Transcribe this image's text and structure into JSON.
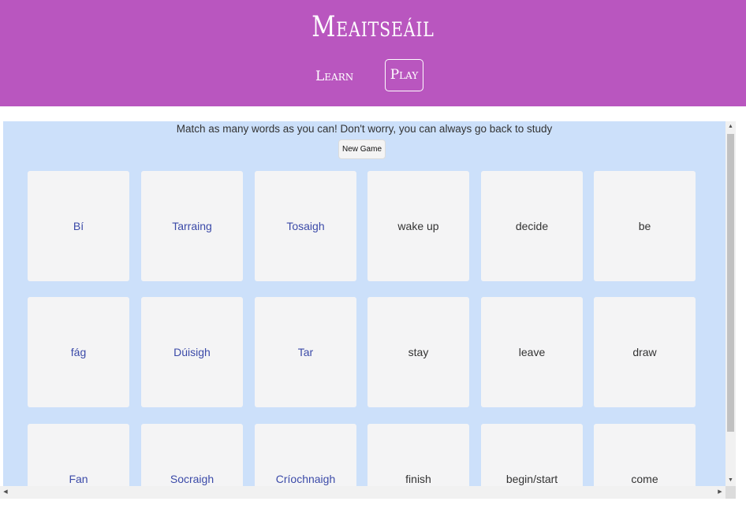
{
  "header": {
    "title": "Meaitseáil",
    "nav": {
      "learn": "Learn",
      "play": "Play"
    }
  },
  "game": {
    "instructions": "Match as many words as you can! Don't worry, you can always go back to study",
    "new_game_label": "New Game",
    "cards": [
      {
        "text": "Bí",
        "lang": "irish"
      },
      {
        "text": "Tarraing",
        "lang": "irish"
      },
      {
        "text": "Tosaigh",
        "lang": "irish"
      },
      {
        "text": "wake up",
        "lang": "english"
      },
      {
        "text": "decide",
        "lang": "english"
      },
      {
        "text": "be",
        "lang": "english"
      },
      {
        "text": "fág",
        "lang": "irish"
      },
      {
        "text": "Dúisigh",
        "lang": "irish"
      },
      {
        "text": "Tar",
        "lang": "irish"
      },
      {
        "text": "stay",
        "lang": "english"
      },
      {
        "text": "leave",
        "lang": "english"
      },
      {
        "text": "draw",
        "lang": "english"
      },
      {
        "text": "Fan",
        "lang": "irish"
      },
      {
        "text": "Socraigh",
        "lang": "irish"
      },
      {
        "text": "Críochnaigh",
        "lang": "irish"
      },
      {
        "text": "finish",
        "lang": "english"
      },
      {
        "text": "begin/start",
        "lang": "english"
      },
      {
        "text": "come",
        "lang": "english"
      }
    ]
  },
  "colors": {
    "header_bg": "#b956bf",
    "board_bg": "#cce0fa",
    "card_bg": "#f4f4f5",
    "irish_text": "#3b4aa8",
    "english_text": "#333333"
  }
}
